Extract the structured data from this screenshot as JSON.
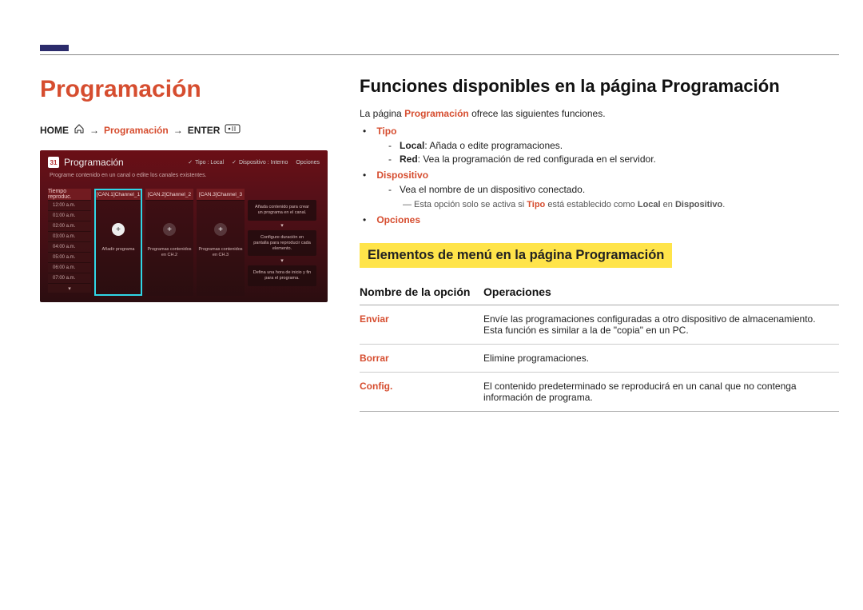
{
  "colors": {
    "accent": "#d64d2f",
    "highlight": "#ffe44a",
    "topAccent": "#2b2b6b"
  },
  "left": {
    "title": "Programación",
    "breadcrumb": {
      "home": "HOME",
      "arrow": "→",
      "page": "Programación",
      "enter": "ENTER"
    },
    "shot": {
      "calendarDay": "31",
      "title": "Programación",
      "subtitle": "Programe contenido en un canal o edite los canales existentes.",
      "hdrRight": {
        "tipoLabel": "Tipo : Local",
        "dispositivoLabel": "Dispositivo : Interno",
        "opciones": "Opciones"
      },
      "timeHeader": "Tiempo reproduc.",
      "times": [
        "12:00 a.m.",
        "01:00 a.m.",
        "02:00 a.m.",
        "03:00 a.m.",
        "04:00 a.m.",
        "05:00 a.m.",
        "06:00 a.m.",
        "07:00 a.m."
      ],
      "channels": [
        {
          "header": "[CAN.1]Channel_1",
          "caption": "Añadir programa",
          "selected": true
        },
        {
          "header": "[CAN.2]Channel_2",
          "caption": "Programas contenidos en CH.2",
          "selected": false
        },
        {
          "header": "[CAN.3]Channel_3",
          "caption": "Programas contenidos en CH.3",
          "selected": false
        }
      ],
      "tips": [
        "Añada contenido para crear un programa en el canal.",
        "Configure duración en pantalla para reproducir cada elemento.",
        "Defina una hora de inicio y fin para el programa."
      ]
    }
  },
  "right": {
    "title": "Funciones disponibles en la página Programación",
    "intro_1": "La página",
    "intro_accent": "Programación",
    "intro_2": "ofrece las siguientes funciones.",
    "bullets": [
      {
        "label": "Tipo",
        "subs": [
          {
            "name": "Local",
            "desc": ": Añada o edite programaciones."
          },
          {
            "name": "Red",
            "desc": ": Vea la programación de red configurada en el servidor."
          }
        ]
      },
      {
        "label": "Dispositivo",
        "subs": [
          {
            "name": "",
            "desc": "Vea el nombre de un dispositivo conectado."
          }
        ],
        "note": {
          "pre": "Esta opción solo se activa si",
          "mid_accent": "Tipo",
          "mid": "está establecido como",
          "b1": "Local",
          "mid2": "en",
          "b2": "Dispositivo",
          "end": "."
        }
      },
      {
        "label": "Opciones"
      }
    ],
    "subsection": "Elementos de menú en la página Programación",
    "table": {
      "headers": [
        "Nombre de la opción",
        "Operaciones"
      ],
      "rows": [
        {
          "name": "Enviar",
          "desc": "Envíe las programaciones configuradas a otro dispositivo de almacenamiento. Esta función es similar a la de \"copia\" en un PC."
        },
        {
          "name": "Borrar",
          "desc": "Elimine programaciones."
        },
        {
          "name": "Config.",
          "desc": "El contenido predeterminado se reproducirá en un canal que no contenga información de programa."
        }
      ]
    }
  }
}
